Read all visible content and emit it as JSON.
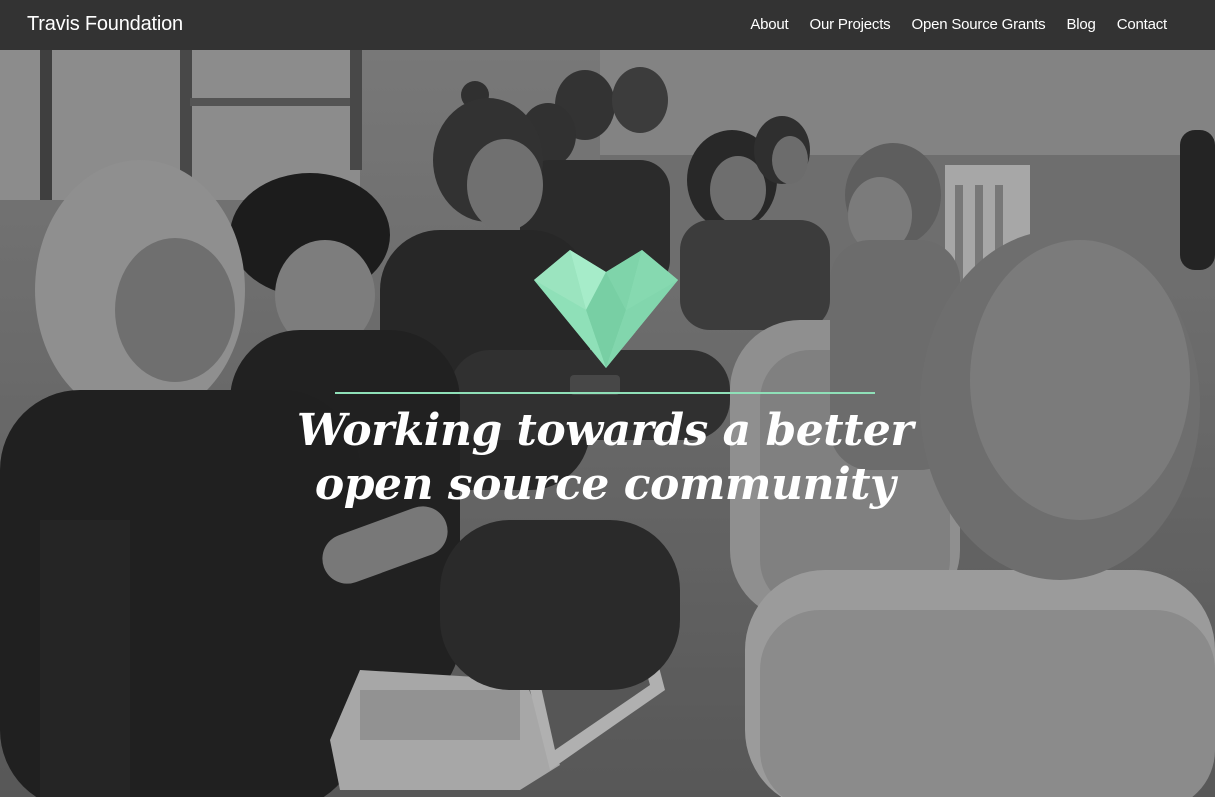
{
  "header": {
    "brand": "Travis Foundation",
    "nav": [
      {
        "label": "About"
      },
      {
        "label": "Our Projects"
      },
      {
        "label": "Open Source Grants"
      },
      {
        "label": "Blog"
      },
      {
        "label": "Contact"
      }
    ]
  },
  "hero": {
    "tagline_line1": "Working towards a better",
    "tagline_line2": "open source community",
    "heart_icon": "heart-icon",
    "accent_color": "#8fe0b8"
  },
  "colors": {
    "navbar": "#333333",
    "text": "#ffffff",
    "accent": "#8fe0b8"
  }
}
